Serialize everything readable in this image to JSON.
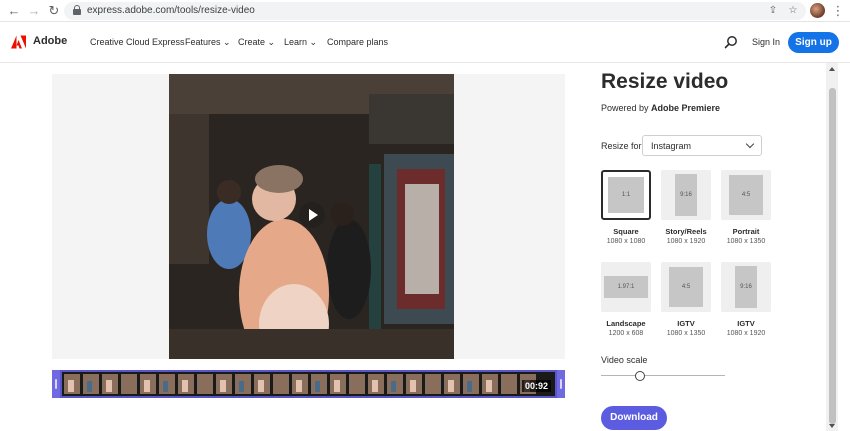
{
  "browser": {
    "back_icon": "←",
    "forward_icon": "→",
    "reload_icon": "↻",
    "url": "express.adobe.com/tools/resize-video",
    "share_icon": "⇪",
    "star_icon": "☆",
    "menu_icon": "⋮"
  },
  "header": {
    "brand": "Adobe",
    "nav": [
      "Creative Cloud Express",
      "Features ⌄",
      "Create ⌄",
      "Learn ⌄",
      "Compare plans"
    ],
    "signin": "Sign In",
    "signup": "Sign up",
    "brand_color": "#eb1000",
    "accent": "#1473e6"
  },
  "timeline": {
    "duration": "00:92"
  },
  "panel": {
    "title": "Resize video",
    "powered_prefix": "Powered by ",
    "powered_product": "Adobe Premiere",
    "resize_for_label": "Resize for:",
    "resize_for_value": "Instagram",
    "tiles": [
      {
        "ratio": "1:1",
        "name": "Square",
        "dims": "1080 x 1080",
        "selected": true
      },
      {
        "ratio": "9:16",
        "name": "Story/Reels",
        "dims": "1080 x 1920",
        "selected": false
      },
      {
        "ratio": "4:5",
        "name": "Portrait",
        "dims": "1080 x 1350",
        "selected": false
      },
      {
        "ratio": "1.97:1",
        "name": "Landscape",
        "dims": "1200 x 608",
        "selected": false
      },
      {
        "ratio": "4:5",
        "name": "IGTV",
        "dims": "1080 x 1350",
        "selected": false
      },
      {
        "ratio": "9:16",
        "name": "IGTV",
        "dims": "1080 x 1920",
        "selected": false
      }
    ],
    "video_scale_label": "Video scale",
    "download": "Download",
    "download_color": "#5c5ce0"
  }
}
